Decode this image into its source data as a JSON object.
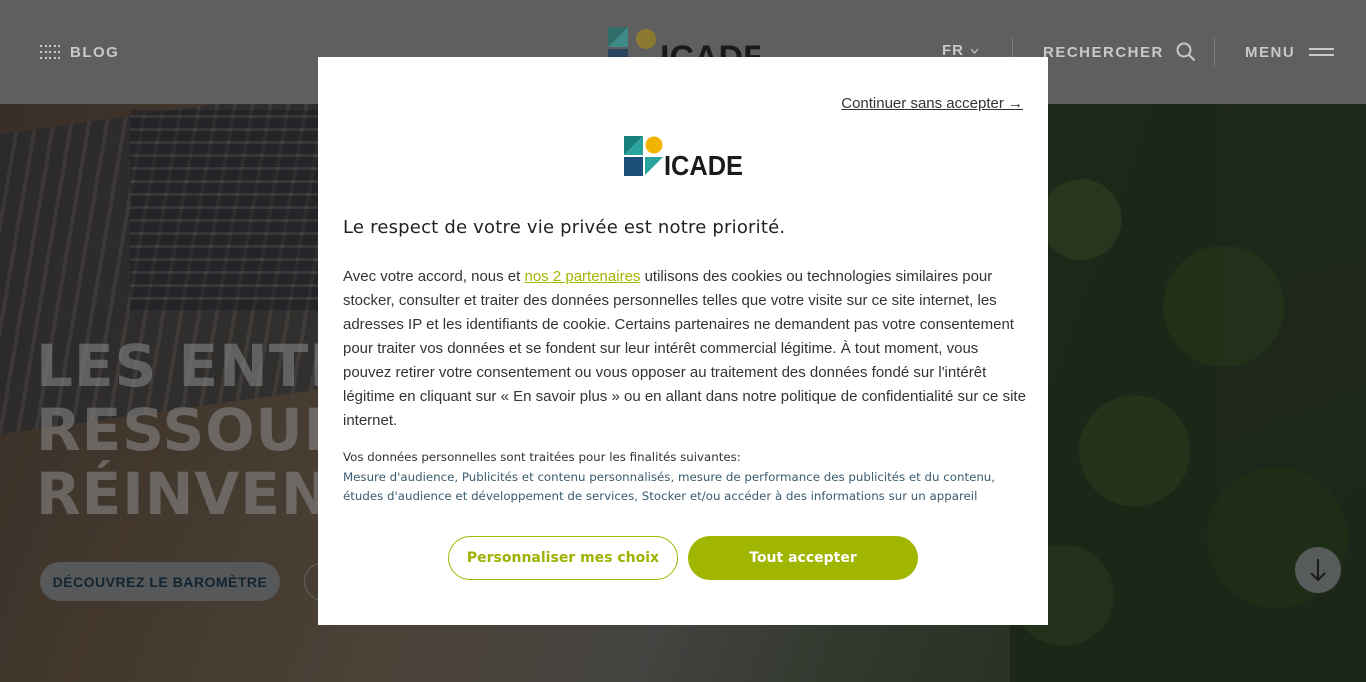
{
  "header": {
    "blog_label": "BLOG",
    "lang_label": "FR",
    "search_label": "RECHERCHER",
    "menu_label": "MENU",
    "logo_text": "ICADE"
  },
  "hero": {
    "headline_lines": [
      "LES ENTRE",
      "RESSOURC",
      "RÉINVENT"
    ],
    "barometer_button": "DÉCOUVREZ LE BAROMÈTRE"
  },
  "modal": {
    "continue_link": "Continuer sans accepter →",
    "logo_text": "ICADE",
    "title": "Le respect de votre vie privée est notre priorité.",
    "body_before_link": "Avec votre accord, nous et ",
    "partners_link": "nos 2 partenaires",
    "body_after_link": " utilisons des cookies ou technologies similaires pour stocker, consulter et traiter des données personnelles telles que votre visite sur ce site internet, les adresses IP et les identifiants de cookie. Certains partenaires ne demandent pas votre consentement pour traiter vos données et se fondent sur leur intérêt commercial légitime. À tout moment, vous pouvez retirer votre consentement ou vous opposer au traitement des données fondé sur l'intérêt légitime en cliquant sur « En savoir plus » ou en allant dans notre politique de confidentialité sur ce site internet.",
    "purposes_intro": "Vos données personnelles sont traitées pour les finalités suivantes:",
    "purposes_list": "Mesure d'audience, Publicités et contenu personnalisés, mesure de performance des publicités et du contenu, études d'audience et développement de services, Stocker et/ou accéder à des informations sur un appareil",
    "customize_button": "Personnaliser mes choix",
    "accept_button": "Tout accepter"
  },
  "colors": {
    "accent_green": "#a0b600",
    "logo_teal": "#1a8e8b",
    "logo_yellow": "#f2b400",
    "logo_blue": "#1d4f7a",
    "logo_dark": "#1b1b1b"
  }
}
